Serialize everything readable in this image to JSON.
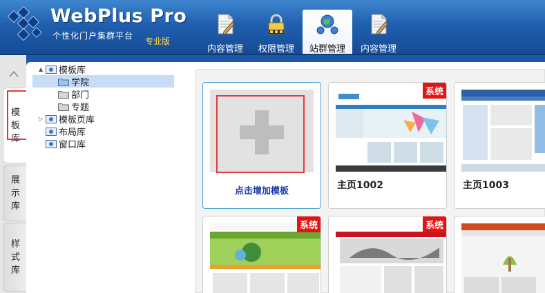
{
  "app": {
    "brand": "WebPlus Pro",
    "tagline": "个性化门户集群平台",
    "edition": "专业版"
  },
  "nav": [
    {
      "label": "内容管理",
      "icon": "document-edit-icon"
    },
    {
      "label": "权限管理",
      "icon": "lock-icon"
    },
    {
      "label": "站群管理",
      "icon": "globe-network-icon",
      "active": true
    },
    {
      "label": "内容管理",
      "icon": "document-edit-icon"
    }
  ],
  "side_tabs": [
    {
      "label": "模板库",
      "active": true
    },
    {
      "label": "展示库"
    },
    {
      "label": "样式库"
    }
  ],
  "tree": {
    "items": [
      {
        "label": "模板库",
        "level": 0,
        "expand": "▲"
      },
      {
        "label": "学院",
        "level": 1,
        "selected": true
      },
      {
        "label": "部门",
        "level": 1
      },
      {
        "label": "专题",
        "level": 1
      },
      {
        "label": "模板页库",
        "level": 0,
        "expand": "▷"
      },
      {
        "label": "布局库",
        "level": 0
      },
      {
        "label": "窗口库",
        "level": 0
      }
    ]
  },
  "templates": {
    "add_label": "点击增加模板",
    "system_badge": "系统",
    "cards": [
      {
        "title": "主页1002",
        "badge": true
      },
      {
        "title": "主页1003",
        "badge": false
      },
      {
        "title": "",
        "badge": true
      },
      {
        "title": "",
        "badge": true
      },
      {
        "title": "",
        "badge": false
      }
    ]
  },
  "colors": {
    "header_blue": "#1f5fae",
    "badge_red": "#e41414",
    "highlight_red": "#e53a3a",
    "selection_blue": "#c7dcf6"
  }
}
